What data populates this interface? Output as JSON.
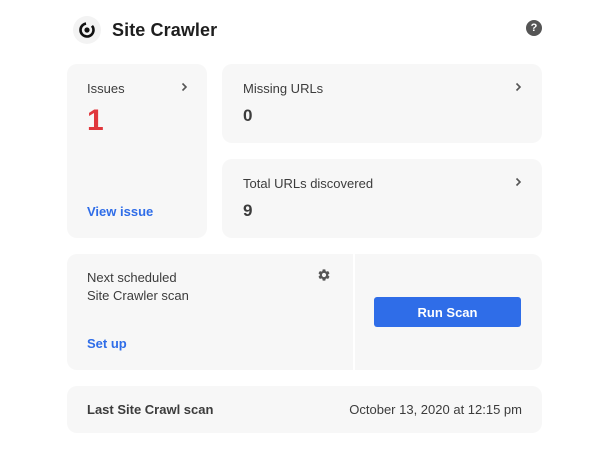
{
  "header": {
    "title": "Site Crawler",
    "logo_icon": "crawler-logo-icon",
    "help_icon": "help-icon",
    "help_glyph": "?"
  },
  "issues": {
    "label": "Issues",
    "count": "1",
    "link": "View issue"
  },
  "missing_urls": {
    "label": "Missing URLs",
    "count": "0"
  },
  "total_urls": {
    "label": "Total URLs discovered",
    "count": "9"
  },
  "schedule": {
    "line1": "Next scheduled",
    "line2": "Site Crawler scan",
    "link": "Set up",
    "settings_icon": "gear-icon",
    "button": "Run Scan"
  },
  "last_scan": {
    "label": "Last Site Crawl scan",
    "date": "October 13, 2020 at 12:15 pm"
  },
  "colors": {
    "accent": "#2f6de8",
    "issue_count": "#e0373c",
    "card_bg": "#f7f7f7"
  }
}
